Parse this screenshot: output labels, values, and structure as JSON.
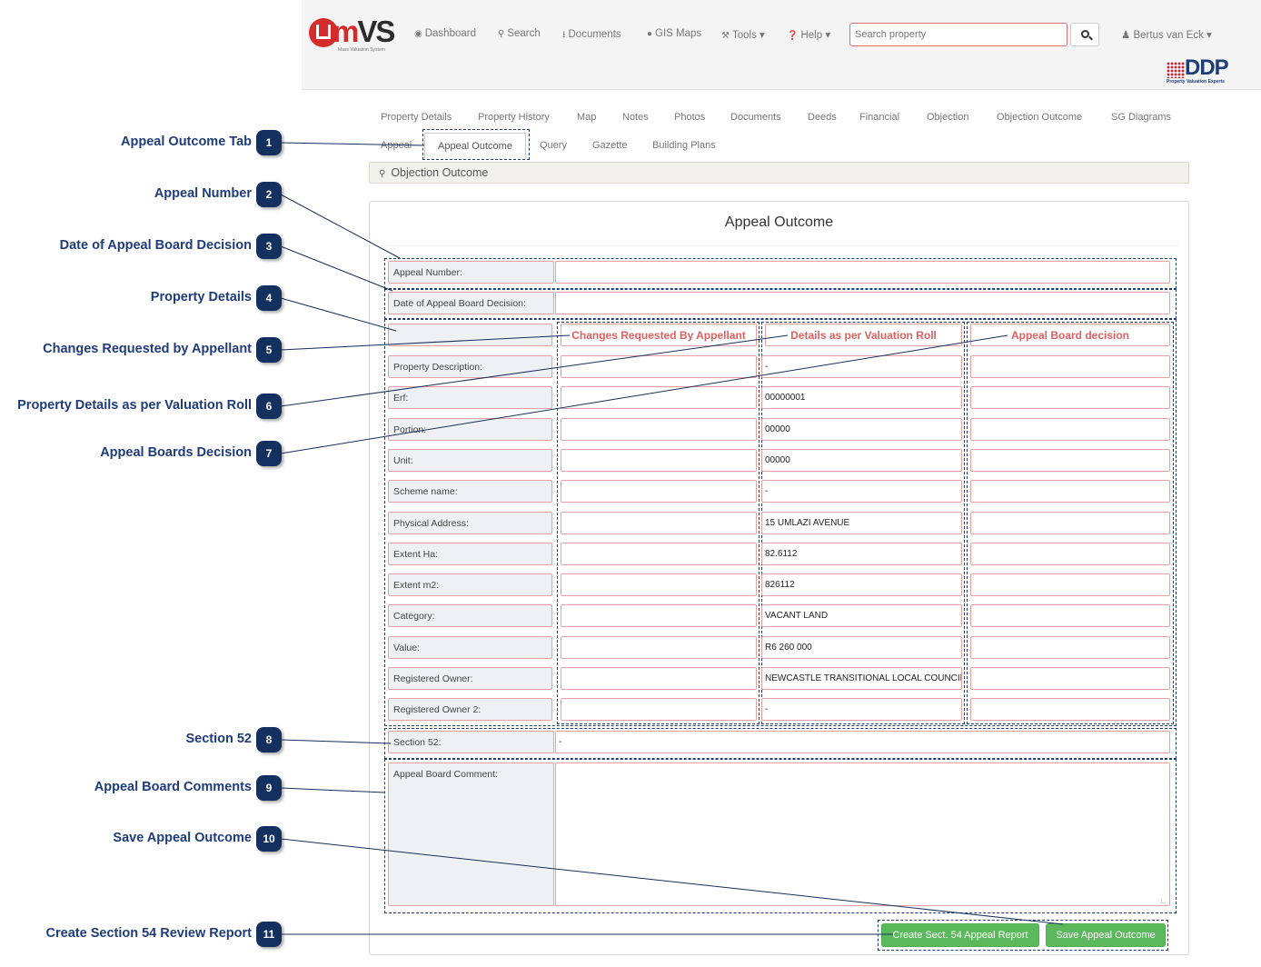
{
  "navbar": {
    "brand": "mvs",
    "brand_sub": "Mass Valuation System",
    "items": [
      {
        "label": "Dashboard",
        "icon": "dashboard-icon"
      },
      {
        "label": "Search",
        "icon": "search-icon"
      },
      {
        "label": "Documents",
        "icon": "upload-icon"
      },
      {
        "label": "GIS Maps",
        "icon": "globe-icon"
      },
      {
        "label": "Tools",
        "icon": "wrench-icon"
      },
      {
        "label": "Help",
        "icon": "question-icon"
      }
    ],
    "search_placeholder": "Search property",
    "user": "Bertus van Eck",
    "partner_logo": "DDP",
    "partner_tagline": "Property Valuation Experts"
  },
  "tabs_row1": [
    "Property Details",
    "Property History",
    "Map",
    "Notes",
    "Photos",
    "Documents",
    "Deeds",
    "Financial",
    "Objection",
    "Objection Outcome",
    "SG Diagrams"
  ],
  "tabs_row2": [
    "Appeal",
    "Appeal Outcome",
    "Query",
    "Gazette",
    "Building Plans"
  ],
  "panel_heading": "Objection Outcome",
  "form": {
    "title": "Appeal Outcome",
    "appeal_number_label": "Appeal Number:",
    "appeal_number_value": "",
    "decision_date_label": "Date of Appeal Board Decision:",
    "decision_date_value": "",
    "col_heads": [
      "Changes Requested By Appellant",
      "Details as per Valuation Roll",
      "Appeal Board decision"
    ],
    "rows": [
      {
        "label": "Property Description:",
        "roll": "-"
      },
      {
        "label": "Erf:",
        "roll": "00000001"
      },
      {
        "label": "Portion:",
        "roll": "00000"
      },
      {
        "label": "Unit:",
        "roll": "00000"
      },
      {
        "label": "Scheme name:",
        "roll": "-"
      },
      {
        "label": "Physical Address:",
        "roll": "15 UMLAZI AVENUE"
      },
      {
        "label": "Extent Ha:",
        "roll": "82.6112"
      },
      {
        "label": "Extent m2:",
        "roll": "826112"
      },
      {
        "label": "Category:",
        "roll": "VACANT LAND"
      },
      {
        "label": "Value:",
        "roll": "R6 260 000"
      },
      {
        "label": "Registered Owner:",
        "roll": "NEWCASTLE TRANSITIONAL LOCAL COUNCIL"
      },
      {
        "label": "Registered Owner 2:",
        "roll": "-"
      }
    ],
    "section52_label": "Section 52:",
    "section52_value": "-",
    "comment_label": "Appeal Board Comment:",
    "btn_report": "Create Sect. 54 Appeal Report",
    "btn_save": "Save Appeal Outcome"
  },
  "callouts": [
    {
      "n": "1",
      "label": "Appeal Outcome Tab"
    },
    {
      "n": "2",
      "label": "Appeal Number"
    },
    {
      "n": "3",
      "label": "Date of Appeal Board Decision"
    },
    {
      "n": "4",
      "label": "Property Details"
    },
    {
      "n": "5",
      "label": "Changes Requested by Appellant"
    },
    {
      "n": "6",
      "label": "Property Details as per Valuation Roll"
    },
    {
      "n": "7",
      "label": "Appeal Boards Decision"
    },
    {
      "n": "8",
      "label": "Section 52"
    },
    {
      "n": "9",
      "label": "Appeal Board Comments"
    },
    {
      "n": "10",
      "label": "Save Appeal Outcome"
    },
    {
      "n": "11",
      "label": "Create Section 54 Review Report"
    }
  ],
  "colors": {
    "callout": "#14305e",
    "accent_red": "#e06060",
    "button_green": "#5cb85c"
  }
}
